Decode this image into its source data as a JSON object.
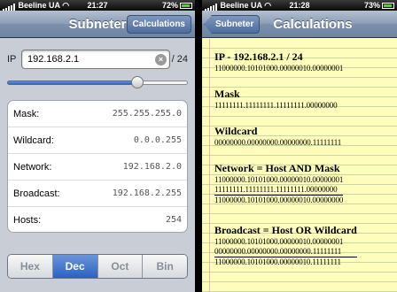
{
  "status": {
    "carrier": "Beeline UA",
    "battery": "72%",
    "battery_right": "73%"
  },
  "left": {
    "time": "21:27",
    "title": "Subneter",
    "calc_button": "Calculations",
    "ip_label": "IP",
    "ip_value": "192.168.2.1",
    "mask_suffix": "/ 24",
    "slider_level": 0.72,
    "rows": [
      {
        "label": "Mask:",
        "value": "255.255.255.0"
      },
      {
        "label": "Wildcard:",
        "value": "0.0.0.255"
      },
      {
        "label": "Network:",
        "value": "192.168.2.0"
      },
      {
        "label": "Broadcast:",
        "value": "192.168.2.255"
      },
      {
        "label": "Hosts:",
        "value": "254"
      }
    ],
    "segments": [
      "Hex",
      "Dec",
      "Oct",
      "Bin"
    ],
    "active_segment": "Dec"
  },
  "right": {
    "time": "21:28",
    "back_button": "Subneter",
    "title": "Calculations",
    "blocks": {
      "ip": {
        "heading": "IP - 192.168.2.1 / 24",
        "lines": [
          "11000000.10101000.00000010.00000001"
        ]
      },
      "mask": {
        "heading": "Mask",
        "lines": [
          "11111111.11111111.11111111.00000000"
        ]
      },
      "wildcard": {
        "heading": "Wildcard",
        "lines": [
          "00000000.00000000.00000000.11111111"
        ]
      },
      "network": {
        "heading": "Network = Host AND Mask",
        "lines": [
          "11000000.10101000.00000010.00000001",
          "11111111.11111111.11111111.00000000",
          "11000000.10101000.00000010.00000000"
        ]
      },
      "broadcast": {
        "heading": "Broadcast = Host OR Wildcard",
        "lines": [
          "11000000.10101000.00000010.00000001",
          "00000000.00000000.00000000.11111111",
          "11000000.10101000.00000010.11111111"
        ]
      }
    }
  },
  "colors": {
    "navbar": "#7d90ac",
    "segment_active": "#2a62c4",
    "paper": "#fffdbb"
  }
}
